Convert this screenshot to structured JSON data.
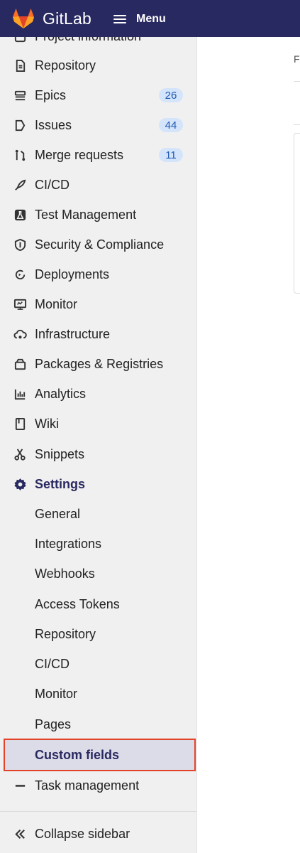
{
  "header": {
    "brand": "GitLab",
    "menu_label": "Menu",
    "bg_color": "#292961"
  },
  "sidebar": {
    "partial_top_item": "Project information",
    "items": [
      {
        "label": "Repository",
        "icon": "file-icon"
      },
      {
        "label": "Epics",
        "icon": "epic-icon",
        "badge": "26"
      },
      {
        "label": "Issues",
        "icon": "issues-icon",
        "badge": "44"
      },
      {
        "label": "Merge requests",
        "icon": "merge-request-icon",
        "badge": "11"
      },
      {
        "label": "CI/CD",
        "icon": "rocket-icon"
      },
      {
        "label": "Test Management",
        "icon": "flask-icon"
      },
      {
        "label": "Security & Compliance",
        "icon": "shield-icon"
      },
      {
        "label": "Deployments",
        "icon": "deployments-icon"
      },
      {
        "label": "Monitor",
        "icon": "monitor-icon"
      },
      {
        "label": "Infrastructure",
        "icon": "cloud-gear-icon"
      },
      {
        "label": "Packages & Registries",
        "icon": "package-icon"
      },
      {
        "label": "Analytics",
        "icon": "chart-icon"
      },
      {
        "label": "Wiki",
        "icon": "book-icon"
      },
      {
        "label": "Snippets",
        "icon": "scissors-icon"
      }
    ],
    "settings": {
      "label": "Settings",
      "icon": "gear-icon",
      "sub_items": [
        "General",
        "Integrations",
        "Webhooks",
        "Access Tokens",
        "Repository",
        "CI/CD",
        "Monitor",
        "Pages",
        "Custom fields"
      ]
    },
    "task_management": "Task management",
    "collapse_label": "Collapse sidebar",
    "selected_item": "Custom fields",
    "highlight_color": "#e24329"
  },
  "main": {
    "partial_letter": "F"
  }
}
